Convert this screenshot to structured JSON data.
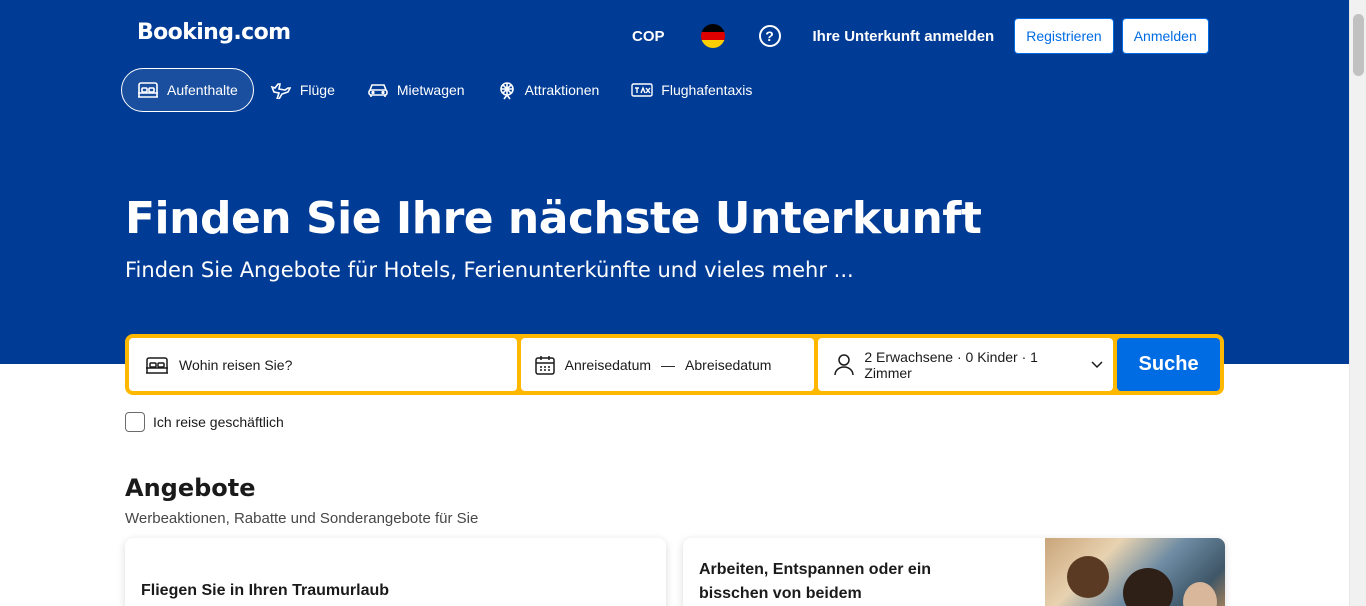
{
  "brand": {
    "logo": "Booking.com"
  },
  "header": {
    "currency": "COP",
    "help": "?",
    "list_property": "Ihre Unterkunft anmelden",
    "register": "Registrieren",
    "login": "Anmelden",
    "flag_colors": [
      "#000000",
      "#dd0000",
      "#ffce00"
    ]
  },
  "nav": {
    "items": [
      {
        "label": "Aufenthalte",
        "icon": "bed-icon",
        "active": true
      },
      {
        "label": "Flüge",
        "icon": "plane-icon",
        "active": false
      },
      {
        "label": "Mietwagen",
        "icon": "car-icon",
        "active": false
      },
      {
        "label": "Attraktionen",
        "icon": "attractions-icon",
        "active": false
      },
      {
        "label": "Flughafentaxis",
        "icon": "taxi-icon",
        "active": false
      }
    ]
  },
  "hero": {
    "title": "Finden Sie Ihre nächste Unterkunft",
    "subtitle": "Finden Sie Angebote für Hotels, Ferienunterkünfte und vieles mehr ..."
  },
  "search": {
    "destination_placeholder": "Wohin reisen Sie?",
    "checkin": "Anreisedatum",
    "date_separator": "—",
    "checkout": "Abreisedatum",
    "guests": "2 Erwachsene · 0 Kinder · 1 Zimmer",
    "button": "Suche"
  },
  "business_trip": {
    "label": "Ich reise geschäftlich",
    "checked": false
  },
  "offers": {
    "title": "Angebote",
    "subtitle": "Werbeaktionen, Rabatte und Sonderangebote für Sie",
    "cards": [
      {
        "title": "Fliegen Sie in Ihren Traumurlaub"
      },
      {
        "title": "Arbeiten, Entspannen oder ein bisschen von beidem"
      }
    ]
  },
  "colors": {
    "brand_blue": "#003b95",
    "accent_blue": "#006ce4",
    "search_border": "#ffb700"
  }
}
